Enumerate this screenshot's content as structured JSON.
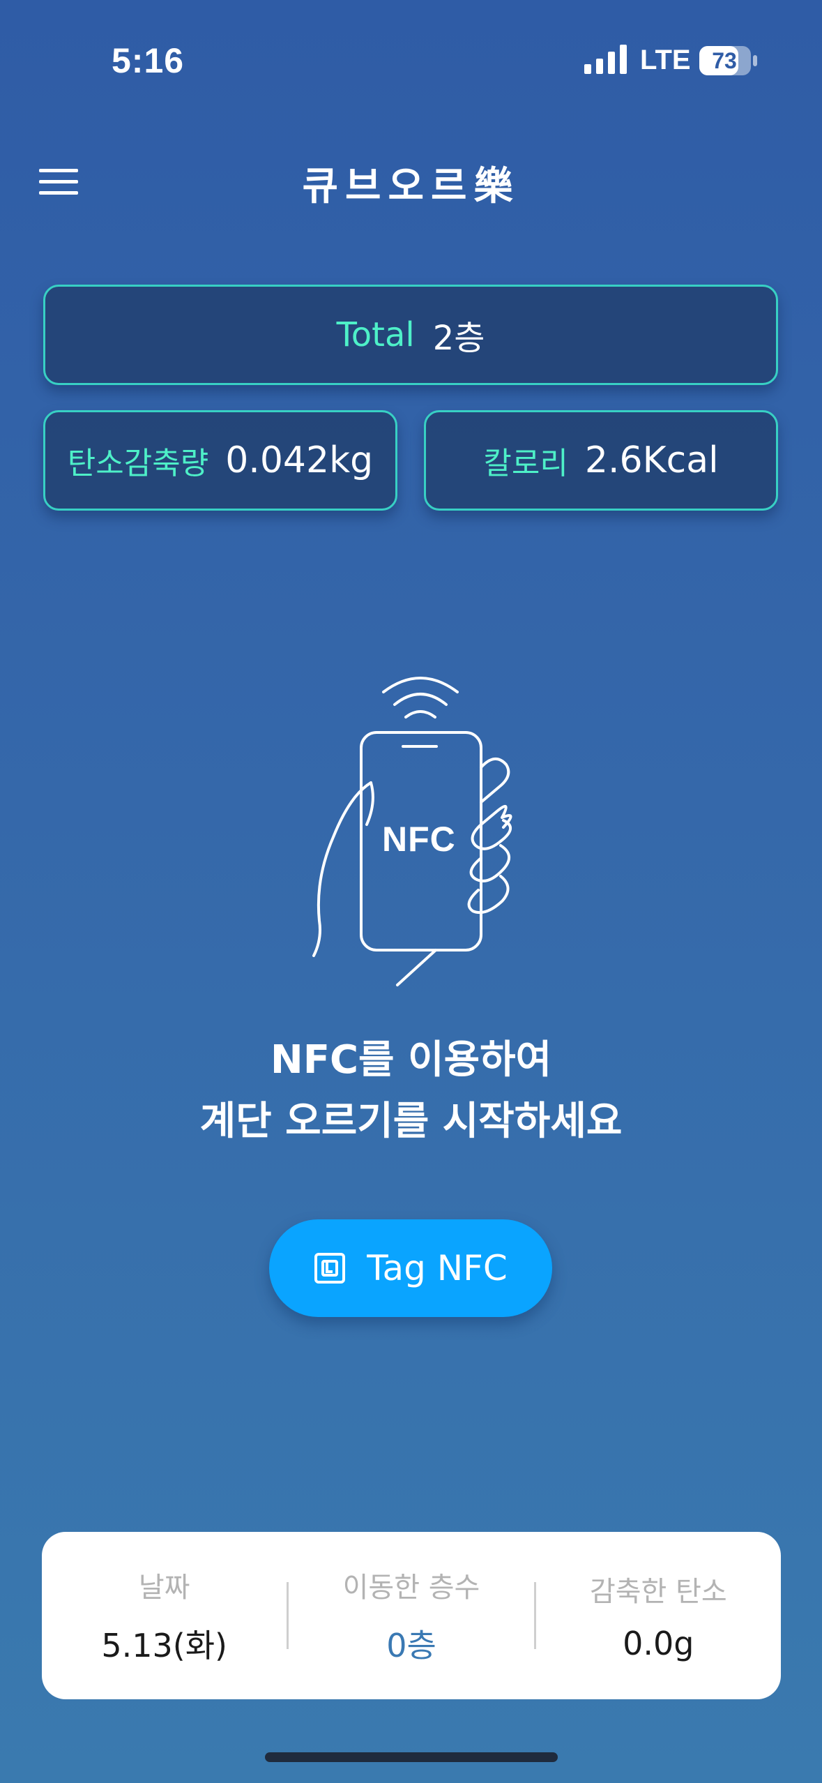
{
  "status_bar": {
    "time": "5:16",
    "network": "LTE",
    "battery": "73",
    "icons": [
      "signal-icon",
      "battery-icon"
    ]
  },
  "header": {
    "title": "큐브오르樂",
    "menu_icon": "hamburger-menu-icon"
  },
  "stats": {
    "total": {
      "label": "Total",
      "value": "2층"
    },
    "carbon": {
      "label": "탄소감축량",
      "value": "0.042kg"
    },
    "calorie": {
      "label": "칼로리",
      "value": "2.6Kcal"
    }
  },
  "illustration": {
    "icon": "hand-holding-phone-nfc-icon",
    "phone_text": "NFC"
  },
  "instruction": {
    "line1": "NFC를 이용하여",
    "line2": "계단 오르기를 시작하세요"
  },
  "tag_button": {
    "label": "Tag NFC",
    "icon": "nfc-chip-icon"
  },
  "summary": {
    "date_label": "날짜",
    "date_value": "5.13(화)",
    "floors_label": "이동한 층수",
    "floors_value": "0층",
    "carbon_label": "감축한 탄소",
    "carbon_value": "0.0g"
  },
  "colors": {
    "accent_mint": "#4ef0c8",
    "button_blue": "#0aa4ff",
    "background_top": "#2f5ca6",
    "background_bottom": "#3a7aaf"
  }
}
